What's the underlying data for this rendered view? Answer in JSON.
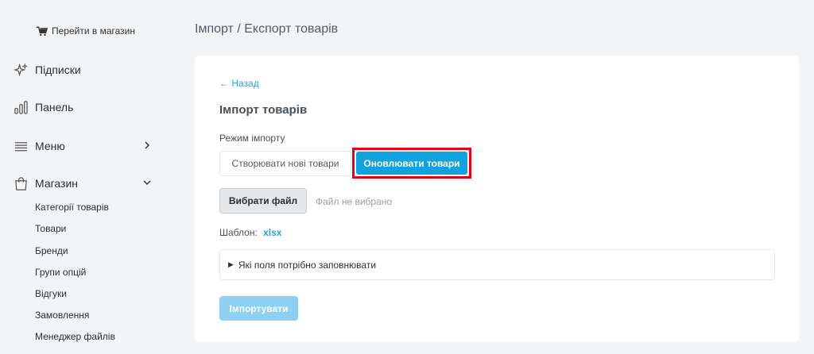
{
  "sidebar": {
    "store_link": "Перейти в магазин",
    "items": [
      {
        "label": "Підписки"
      },
      {
        "label": "Панель"
      },
      {
        "label": "Меню"
      },
      {
        "label": "Магазин"
      }
    ],
    "sub_items": [
      "Категорії товарів",
      "Товари",
      "Бренди",
      "Групи опцій",
      "Відгуки",
      "Замовлення",
      "Менеджер файлів"
    ]
  },
  "header": {
    "title": "Імпорт / Експорт товарів"
  },
  "card": {
    "back": "← Назад",
    "title": "Імпорт товарів",
    "mode_label": "Режим імпорту",
    "mode_create": "Створювати нові товари",
    "mode_update": "Оновлювати товари",
    "file_button": "Вибрати файл",
    "file_status": "Файл не вибрано",
    "template_label": "Шаблон:",
    "template_link": "xlsx",
    "details_summary": "Які поля потрібно заповнювати",
    "import_button": "Імпортувати"
  },
  "colors": {
    "accent": "#12a2df",
    "link": "#2c9fd9",
    "highlight": "#e3001b",
    "disabled_button": "#8ed0f2"
  }
}
